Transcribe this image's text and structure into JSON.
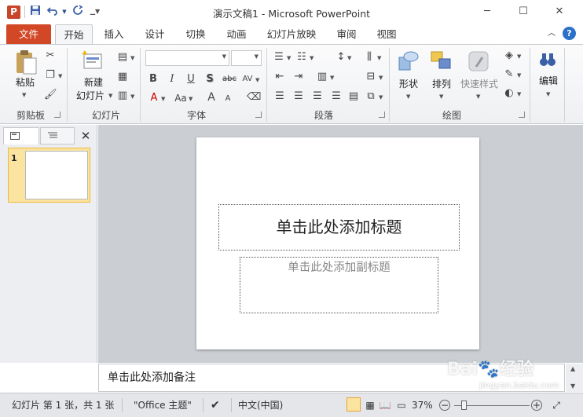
{
  "window": {
    "title": "演示文稿1  -  Microsoft PowerPoint",
    "app_icon": "P",
    "minimize": "─",
    "maximize": "☐",
    "close": "✕"
  },
  "quick_access": {
    "save_icon": "floppy-disk",
    "undo_icon": "undo-arrow",
    "redo_icon": "redo-arrow"
  },
  "tabs": {
    "file": "文件",
    "items": [
      "开始",
      "插入",
      "设计",
      "切换",
      "动画",
      "幻灯片放映",
      "审阅",
      "视图"
    ],
    "active": "开始"
  },
  "ribbon": {
    "clipboard": {
      "paste": "粘贴",
      "label": "剪贴板"
    },
    "slides": {
      "new_slide_line1": "新建",
      "new_slide_line2": "幻灯片",
      "label": "幻灯片"
    },
    "font": {
      "label": "字体",
      "bold": "B",
      "italic": "I",
      "underline": "U",
      "shadow": "S",
      "strike": "abc",
      "spacing": "AV",
      "color": "A",
      "case": "Aa",
      "grow": "A",
      "shrink": "A"
    },
    "paragraph": {
      "label": "段落"
    },
    "drawing": {
      "shapes": "形状",
      "arrange": "排列",
      "quick_styles": "快速样式",
      "label": "绘图"
    },
    "editing": {
      "label": "编辑"
    }
  },
  "left_pane": {
    "slide_number": "1"
  },
  "slide": {
    "title_placeholder": "单击此处添加标题",
    "subtitle_placeholder": "单击此处添加副标题"
  },
  "notes": {
    "placeholder": "单击此处添加备注"
  },
  "status_bar": {
    "slide_info": "幻灯片 第 1 张，共 1 张",
    "theme": "\"Office 主题\"",
    "language": "中文(中国)",
    "zoom": "37%"
  },
  "watermark": {
    "brand": "Bai",
    "suffix": "经验",
    "url": "jingyan.baidu.com"
  },
  "colors": {
    "file_tab": "#d24726",
    "accent_blue": "#2b71c9",
    "selected_thumb": "#f7d36a"
  }
}
